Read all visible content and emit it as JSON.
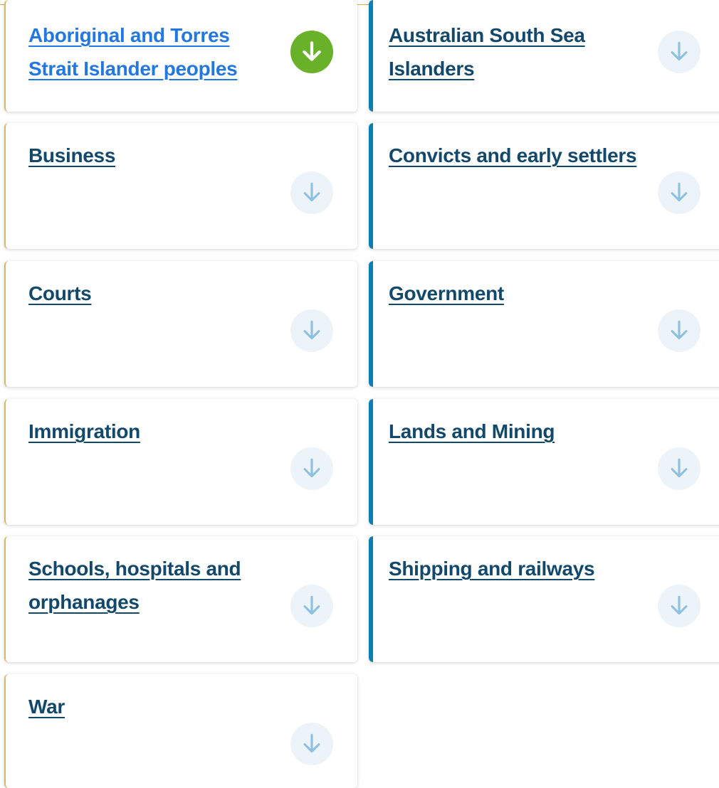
{
  "theme": {
    "link_color": "#12486b",
    "active_link_color": "#2277e0",
    "accent_bar_color": "#0b7fb4",
    "download_active_bg": "#6ab12a",
    "download_inactive_bg": "#edf4f9",
    "download_inactive_arrow": "#8ec0e0"
  },
  "categories": [
    {
      "label": "Aboriginal and Torres Strait Islander peoples",
      "icon": "arrow-down-icon",
      "active": true
    },
    {
      "label": "Australian South Sea Islanders",
      "icon": "arrow-down-icon",
      "active": false
    },
    {
      "label": "Business",
      "icon": "arrow-down-icon",
      "active": false
    },
    {
      "label": "Convicts and early settlers",
      "icon": "arrow-down-icon",
      "active": false
    },
    {
      "label": "Courts",
      "icon": "arrow-down-icon",
      "active": false
    },
    {
      "label": "Government",
      "icon": "arrow-down-icon",
      "active": false
    },
    {
      "label": "Immigration",
      "icon": "arrow-down-icon",
      "active": false
    },
    {
      "label": "Lands and Mining",
      "icon": "arrow-down-icon",
      "active": false
    },
    {
      "label": "Schools, hospitals and orphanages",
      "icon": "arrow-down-icon",
      "active": false
    },
    {
      "label": "Shipping and railways",
      "icon": "arrow-down-icon",
      "active": false
    },
    {
      "label": "War",
      "icon": "arrow-down-icon",
      "active": false
    }
  ]
}
